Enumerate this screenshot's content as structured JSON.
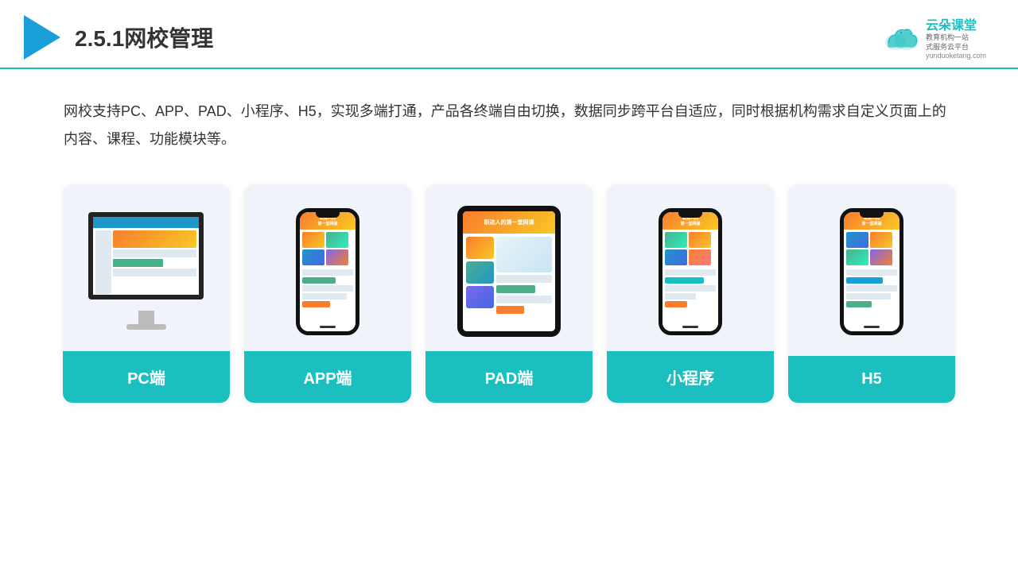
{
  "header": {
    "title": "2.5.1网校管理",
    "logo_brand": "云朵课堂",
    "logo_sub1": "教育机构一站",
    "logo_sub2": "式服务云平台",
    "logo_url": "yunduoketang.com"
  },
  "description": {
    "text": "网校支持PC、APP、PAD、小程序、H5，实现多端打通，产品各终端自由切换，数据同步跨平台自适应，同时根据机构需求自定义页面上的内容、课程、功能模块等。"
  },
  "cards": [
    {
      "id": "pc",
      "label": "PC端"
    },
    {
      "id": "app",
      "label": "APP端"
    },
    {
      "id": "pad",
      "label": "PAD端"
    },
    {
      "id": "miniprogram",
      "label": "小程序"
    },
    {
      "id": "h5",
      "label": "H5"
    }
  ]
}
